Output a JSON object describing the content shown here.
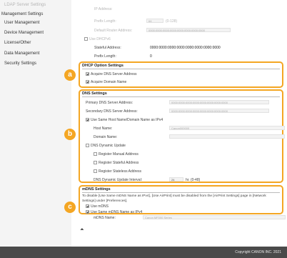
{
  "sidebar": {
    "items": [
      {
        "label": "LDAP Server Settings",
        "faded": true
      },
      {
        "label": "Management Settings",
        "faded": false
      },
      {
        "label": "User Management",
        "faded": false
      },
      {
        "label": "Device Management",
        "faded": false
      },
      {
        "label": "License/Other",
        "faded": false
      },
      {
        "label": "Data Management",
        "faded": false
      },
      {
        "label": "Security Settings",
        "faded": false
      }
    ]
  },
  "ipv6": {
    "ip_address_label": "IP Address:",
    "prefix_length_label": "Prefix Length:",
    "prefix_length_value": "64",
    "prefix_range": "(0-128)",
    "default_router_label": "Default Router Address:",
    "default_router_value": "0000:0000:0000:0000:0000:0000:0000:0000",
    "use_dhcpv6_label": "Use DHCPv6",
    "stateful_label": "Stateful Address:",
    "stateful_value": "0000:0000:0000:0000:0000:0000:0000:0000",
    "prefix_length2_label": "Prefix Length:",
    "prefix_length2_value": "0"
  },
  "dhcp_option": {
    "badge": "a",
    "title": "DHCP Option Settings",
    "acquire_dns_label": "Acquire DNS Server Address",
    "acquire_domain_label": "Acquire Domain Name"
  },
  "dns": {
    "badge": "b",
    "title": "DNS Settings",
    "primary_label": "Primary DNS Server Address:",
    "primary_value": "0000:0000:0000:0000:0000:0000:0000:0000",
    "secondary_label": "Secondary DNS Server Address:",
    "secondary_value": "0000:0000:0000:0000:0000:0000:0000:0000",
    "use_same_host_label": "Use Same Host Name/Domain Name as IPv4",
    "host_name_label": "Host Name:",
    "host_name_value": "Canon000000",
    "domain_name_label": "Domain Name:",
    "domain_name_value": "",
    "dynamic_update_label": "DNS Dynamic Update",
    "register_manual_label": "Register Manual Address",
    "register_stateful_label": "Register Stateful Address",
    "register_stateless_label": "Register Stateless Address",
    "interval_label": "DNS Dynamic Update Interval:",
    "interval_value": "24",
    "interval_unit": "hr. (0-48)"
  },
  "mdns": {
    "badge": "c",
    "title": "mDNS Settings",
    "note": "To disable [Use Same mDNS Name as IPv4], [Use AirPrint] must be disabled from the [AirPrint Settings] page in [Network Settings] under [Preferences].",
    "use_mdns_label": "Use mDNS",
    "use_same_mdns_label": "Use Same mDNS Name as IPv4",
    "mdns_name_label": "mDNS Name:",
    "mdns_name_value": "Canon MF000 Series"
  },
  "scroll_top_icon": "double-up-arrow",
  "footer": {
    "copyright": "Copyright CANON INC. 2021"
  },
  "colors": {
    "accent": "#f4a623",
    "footer_bg": "#4a4a4a"
  }
}
